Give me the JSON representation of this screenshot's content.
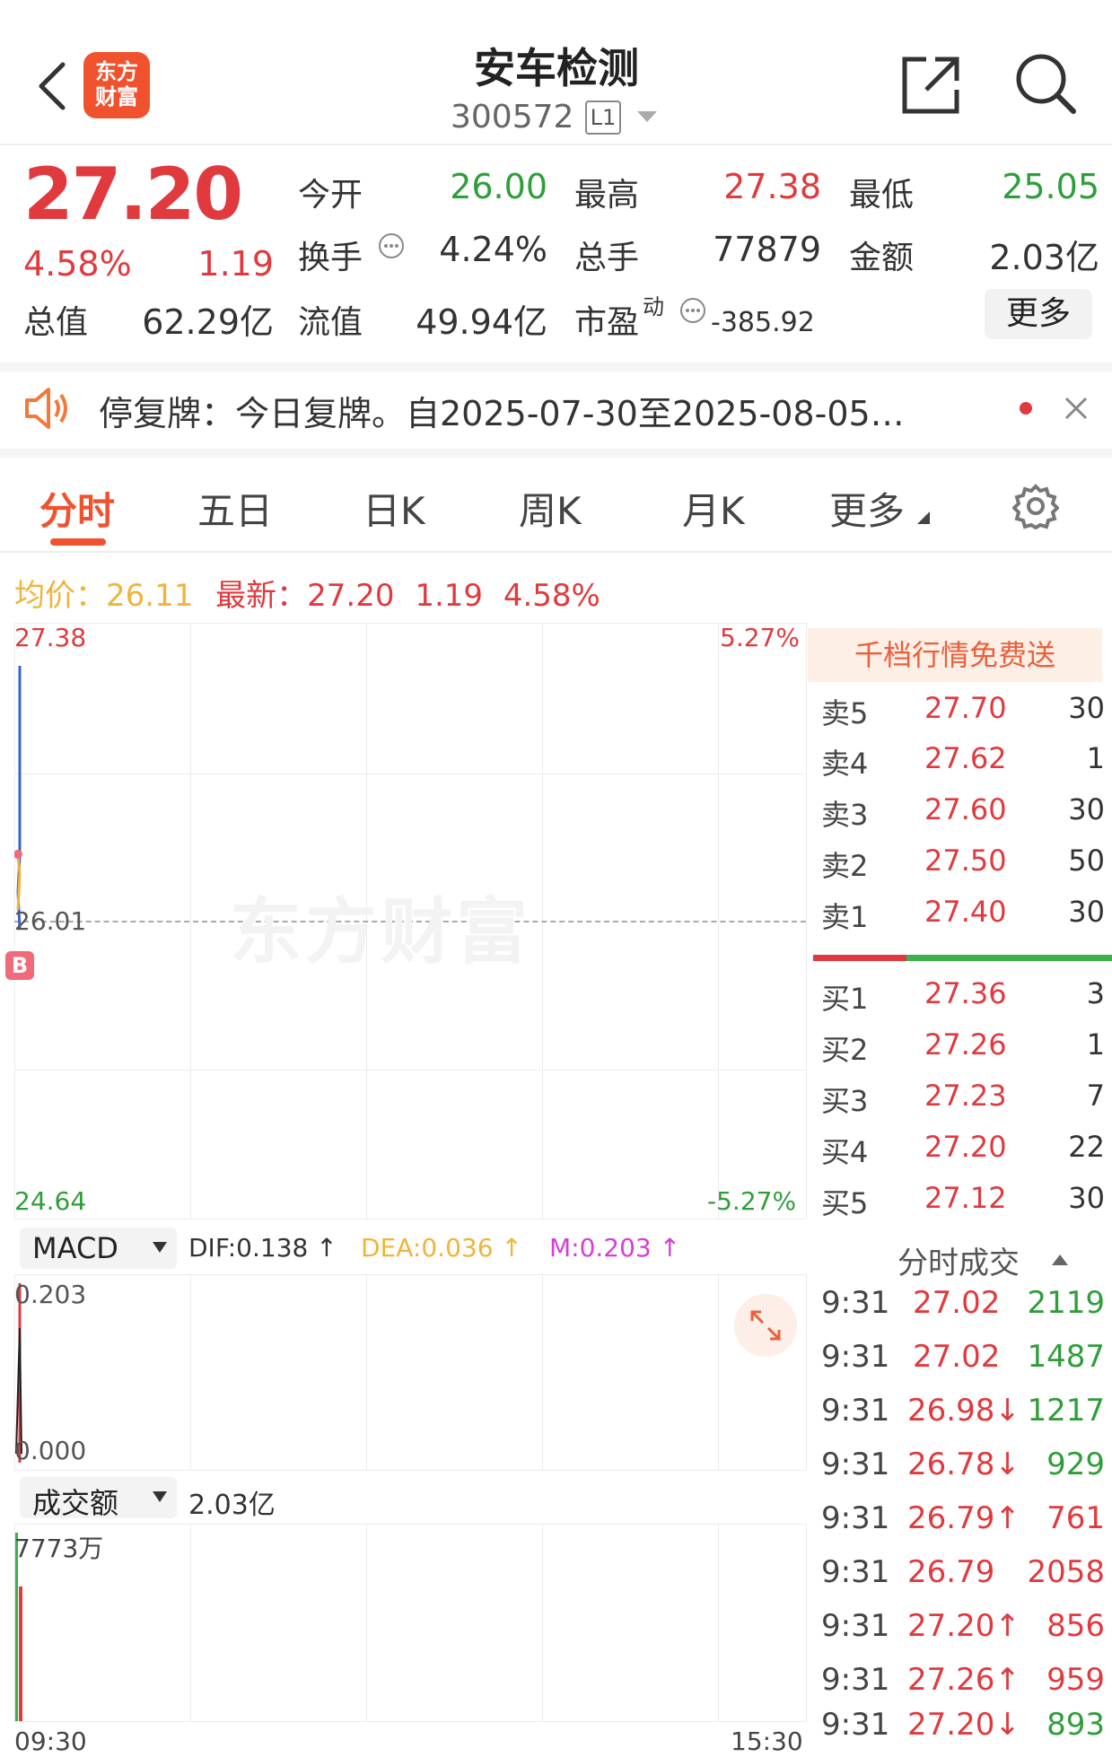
{
  "header": {
    "title": "安车检测",
    "code": "300572",
    "level_badge": "L1",
    "brand_line1": "东方",
    "brand_line2": "财富"
  },
  "quote": {
    "price": "27.20",
    "change_pct": "4.58%",
    "change": "1.19",
    "open_label": "今开",
    "open_value": "26.00",
    "high_label": "最高",
    "high_value": "27.38",
    "low_label": "最低",
    "low_value": "25.05",
    "turnover_label": "换手",
    "turnover_value": "4.24%",
    "volume_label": "总手",
    "volume_value": "77879",
    "amount_label": "金额",
    "amount_value": "2.03亿",
    "mktcap_label": "总值",
    "mktcap_value": "62.29亿",
    "float_label": "流值",
    "float_value": "49.94亿",
    "pe_label": "市盈",
    "pe_sup": "动",
    "pe_value": "-385.92",
    "more_button": "更多"
  },
  "notice": {
    "text": "停复牌：今日复牌。自2025-07-30至2025-08-05…"
  },
  "tabs": [
    "分时",
    "五日",
    "日K",
    "周K",
    "月K",
    "更多"
  ],
  "info_bar": {
    "avg_label": "均价：",
    "avg_value": "26.11",
    "latest_label": "最新：",
    "latest_value": "27.20",
    "latest_change": "1.19",
    "latest_pct": "4.58%"
  },
  "price_chart": {
    "y_max": "27.38",
    "y_min": "24.64",
    "y_mid": "26.01",
    "pct_max": "5.27%",
    "pct_min": "-5.27%",
    "marker": "B",
    "watermark": "东方财富"
  },
  "macd": {
    "selector": "MACD",
    "dif": "DIF:0.138 ↑",
    "dea": "DEA:0.036 ↑",
    "m": "M:0.203 ↑",
    "y_max": "0.203",
    "y_min": "0.000"
  },
  "volume": {
    "selector": "成交额",
    "total": "2.03亿",
    "y_max": "7773万",
    "time_start": "09:30",
    "time_end": "15:30"
  },
  "orderbook": {
    "promo": "千档行情免费送",
    "asks": [
      {
        "label": "卖5",
        "price": "27.70",
        "qty": "30"
      },
      {
        "label": "卖4",
        "price": "27.62",
        "qty": "1"
      },
      {
        "label": "卖3",
        "price": "27.60",
        "qty": "30"
      },
      {
        "label": "卖2",
        "price": "27.50",
        "qty": "50"
      },
      {
        "label": "卖1",
        "price": "27.40",
        "qty": "30"
      }
    ],
    "bids": [
      {
        "label": "买1",
        "price": "27.36",
        "qty": "3"
      },
      {
        "label": "买2",
        "price": "27.26",
        "qty": "1"
      },
      {
        "label": "买3",
        "price": "27.23",
        "qty": "7"
      },
      {
        "label": "买4",
        "price": "27.20",
        "qty": "22"
      },
      {
        "label": "买5",
        "price": "27.12",
        "qty": "30"
      }
    ]
  },
  "trades": {
    "title": "分时成交",
    "rows": [
      {
        "time": "9:31",
        "price": "27.02",
        "vol": "2119"
      },
      {
        "time": "9:31",
        "price": "27.02",
        "vol": "1487"
      },
      {
        "time": "9:31",
        "price": "26.98↓",
        "vol": "1217"
      },
      {
        "time": "9:31",
        "price": "26.78↓",
        "vol": "929"
      },
      {
        "time": "9:31",
        "price": "26.79↑",
        "vol": "761"
      },
      {
        "time": "9:31",
        "price": "26.79",
        "vol": "2058"
      },
      {
        "time": "9:31",
        "price": "27.20↑",
        "vol": "856"
      },
      {
        "time": "9:31",
        "price": "27.26↑",
        "vol": "959"
      },
      {
        "time": "9:31",
        "price": "27.20↓",
        "vol": "893"
      }
    ]
  },
  "colors": {
    "up": "#e03a3e",
    "down": "#2f9e3a",
    "accent": "#f0522e",
    "avg": "#f0b43c",
    "macd_m": "#d63fd6"
  }
}
